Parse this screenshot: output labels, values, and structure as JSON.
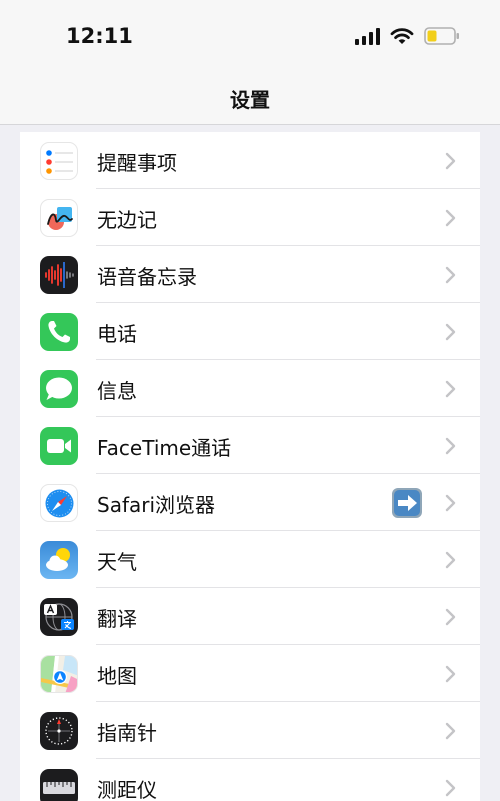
{
  "status_bar": {
    "time": "12:11"
  },
  "nav": {
    "title": "设置"
  },
  "rows": [
    {
      "label": "提醒事项",
      "icon": "reminders-icon"
    },
    {
      "label": "无边记",
      "icon": "freeform-icon"
    },
    {
      "label": "语音备忘录",
      "icon": "voice-memos-icon"
    },
    {
      "label": "电话",
      "icon": "phone-icon"
    },
    {
      "label": "信息",
      "icon": "messages-icon"
    },
    {
      "label": "FaceTime通话",
      "icon": "facetime-icon"
    },
    {
      "label": "Safari浏览器",
      "icon": "safari-icon",
      "badge": "right-arrow-emoji-icon"
    },
    {
      "label": "天气",
      "icon": "weather-icon"
    },
    {
      "label": "翻译",
      "icon": "translate-icon"
    },
    {
      "label": "地图",
      "icon": "maps-icon"
    },
    {
      "label": "指南针",
      "icon": "compass-icon"
    },
    {
      "label": "测距仪",
      "icon": "measure-icon"
    }
  ],
  "colors": {
    "accent_green": "#34c759",
    "chevron": "#c4c4c7",
    "background": "#efeff4"
  }
}
